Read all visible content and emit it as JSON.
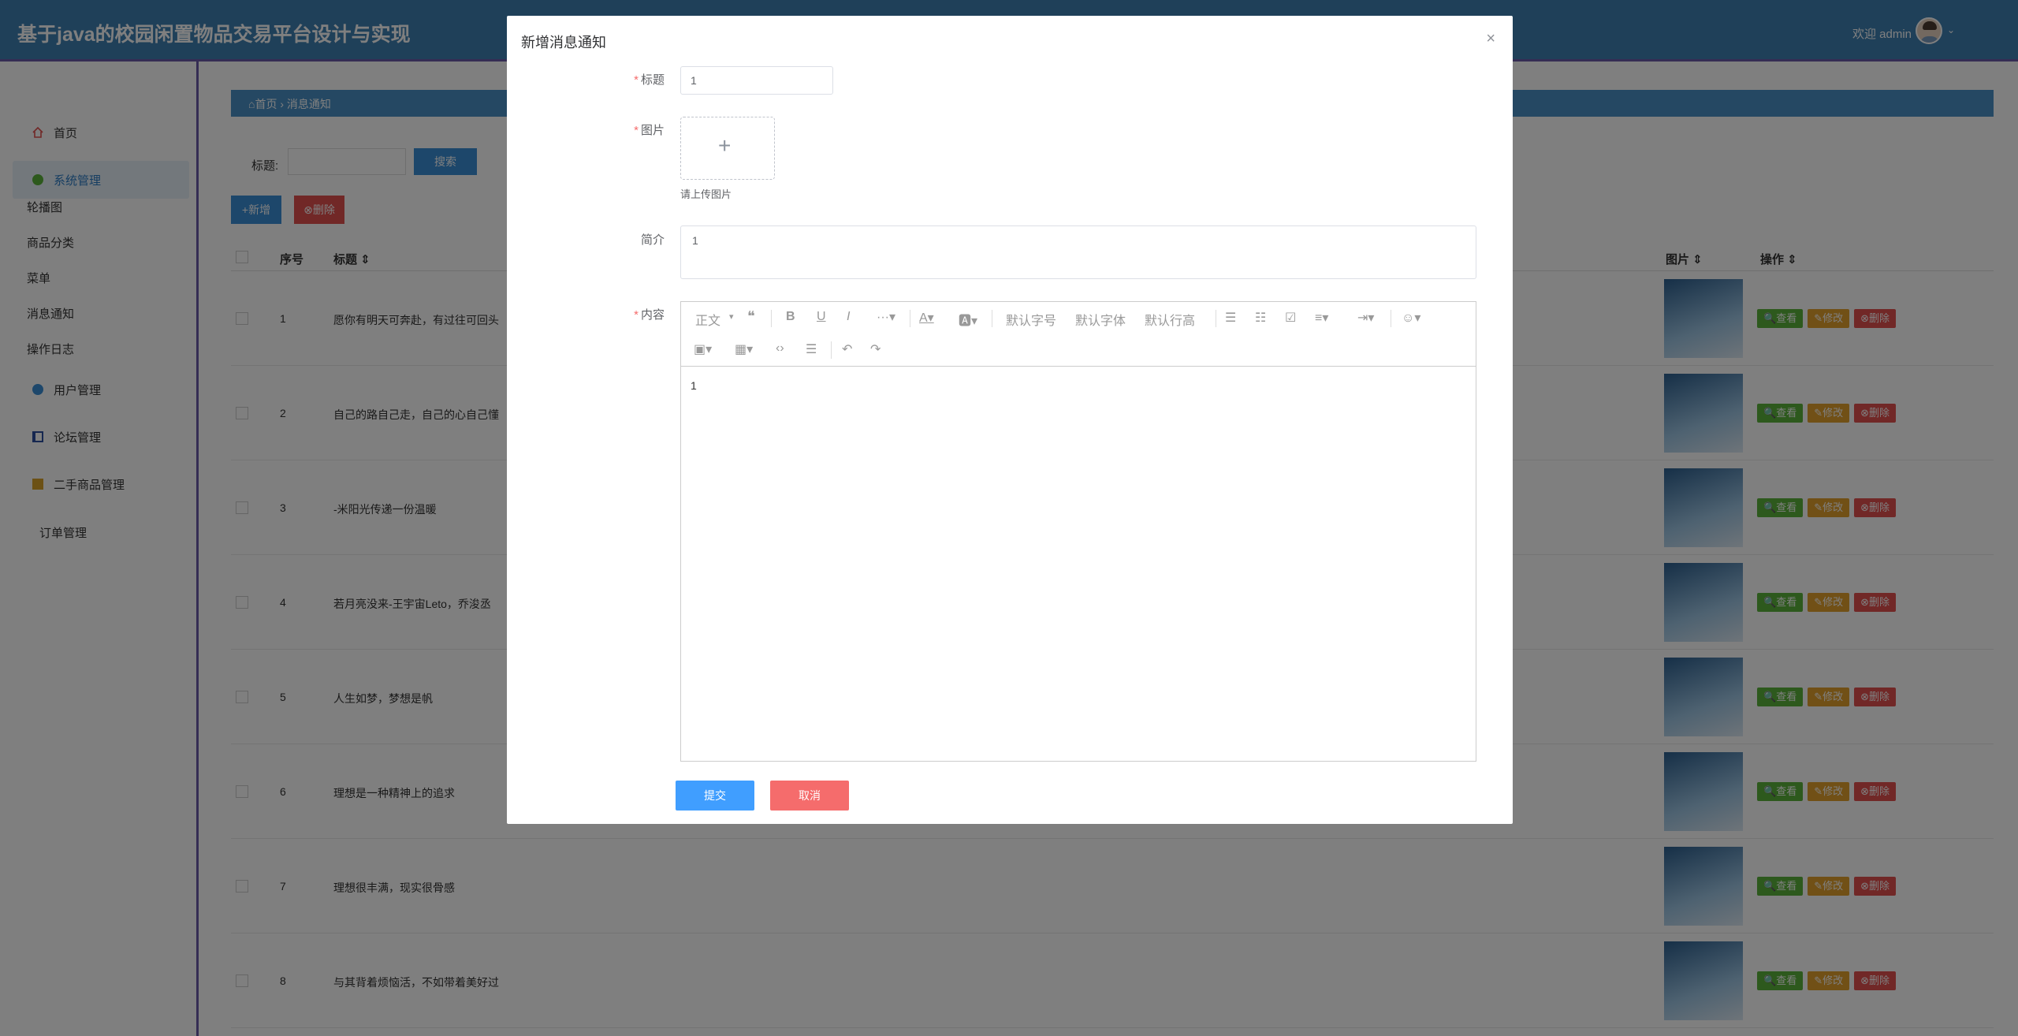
{
  "header": {
    "title": "基于java的校园闲置物品交易平台设计与实现",
    "welcome": "欢迎 admin"
  },
  "sidebar": {
    "home": "首页",
    "system": "系统管理",
    "sub_items": [
      "轮播图",
      "商品分类",
      "菜单",
      "消息通知",
      "操作日志"
    ],
    "user": "用户管理",
    "forum": "论坛管理",
    "goods": "二手商品管理",
    "orders": "订单管理"
  },
  "main": {
    "breadcrumb": "⌂首页 › 消息通知",
    "search_label": "标题:",
    "search_button": "搜索",
    "add_button": "+新增",
    "delete_button": "⊗删除",
    "columns": {
      "index": "序号",
      "title": "标题 ⇕",
      "picture": "图片 ⇕",
      "ops": "操作 ⇕"
    },
    "rows": [
      {
        "idx": "1",
        "title": "愿你有明天可奔赴，有过往可回头"
      },
      {
        "idx": "2",
        "title": "自己的路自己走，自己的心自己懂"
      },
      {
        "idx": "3",
        "title": "-米阳光传递一份温暖"
      },
      {
        "idx": "4",
        "title": "若月亮没来-王宇宙Leto，乔浚丞"
      },
      {
        "idx": "5",
        "title": "人生如梦，梦想是帆"
      },
      {
        "idx": "6",
        "title": "理想是一种精神上的追求"
      },
      {
        "idx": "7",
        "title": "理想很丰满，现实很骨感"
      },
      {
        "idx": "8",
        "title": "与其背着烦恼活，不如带着美好过"
      }
    ],
    "op_view": "查看",
    "op_edit": "修改",
    "op_delete": "删除"
  },
  "modal": {
    "title": "新增消息通知",
    "label_title": "标题",
    "label_picture": "图片",
    "label_intro": "简介",
    "label_content": "内容",
    "title_value": "1",
    "upload_tip": "请上传图片",
    "intro_value": "1",
    "content_value": "1",
    "toolbar": {
      "paragraph": "正文",
      "font_size": "默认字号",
      "font_family": "默认字体",
      "line_height": "默认行高"
    },
    "submit": "提交",
    "cancel": "取消"
  }
}
